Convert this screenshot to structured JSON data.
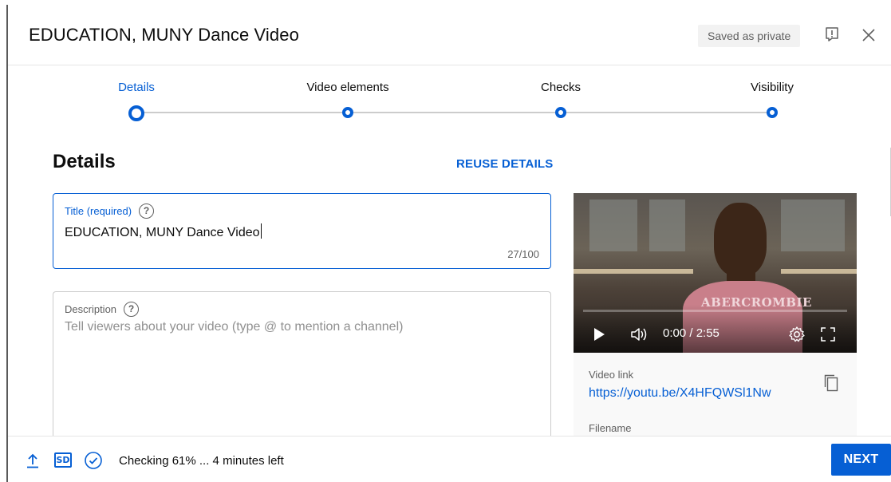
{
  "header": {
    "title": "EDUCATION, MUNY Dance Video",
    "saved_badge": "Saved as private",
    "feedback_icon": "feedback-icon",
    "close_icon": "close-icon"
  },
  "stepper": {
    "steps": [
      {
        "label": "Details",
        "active": true
      },
      {
        "label": "Video elements",
        "active": false
      },
      {
        "label": "Checks",
        "active": false
      },
      {
        "label": "Visibility",
        "active": false
      }
    ]
  },
  "details": {
    "section_title": "Details",
    "reuse_label": "REUSE DETAILS",
    "title_field": {
      "label": "Title (required)",
      "value": "EDUCATION, MUNY Dance Video",
      "counter": "27/100"
    },
    "description_field": {
      "label": "Description",
      "placeholder": "Tell viewers about your video (type @ to mention a channel)"
    },
    "help_glyph": "?"
  },
  "video": {
    "shirt_text": "ABERCROMBIE",
    "time": "0:00 / 2:55",
    "link_label": "Video link",
    "link": "https://youtu.be/X4HFQWSl1Nw",
    "filename_label": "Filename"
  },
  "footer": {
    "sd_label": "SD",
    "status": "Checking 61% ... 4 minutes left",
    "next_label": "NEXT"
  },
  "colors": {
    "accent": "#065fd4",
    "border": "#cccccc",
    "muted": "#606060"
  }
}
